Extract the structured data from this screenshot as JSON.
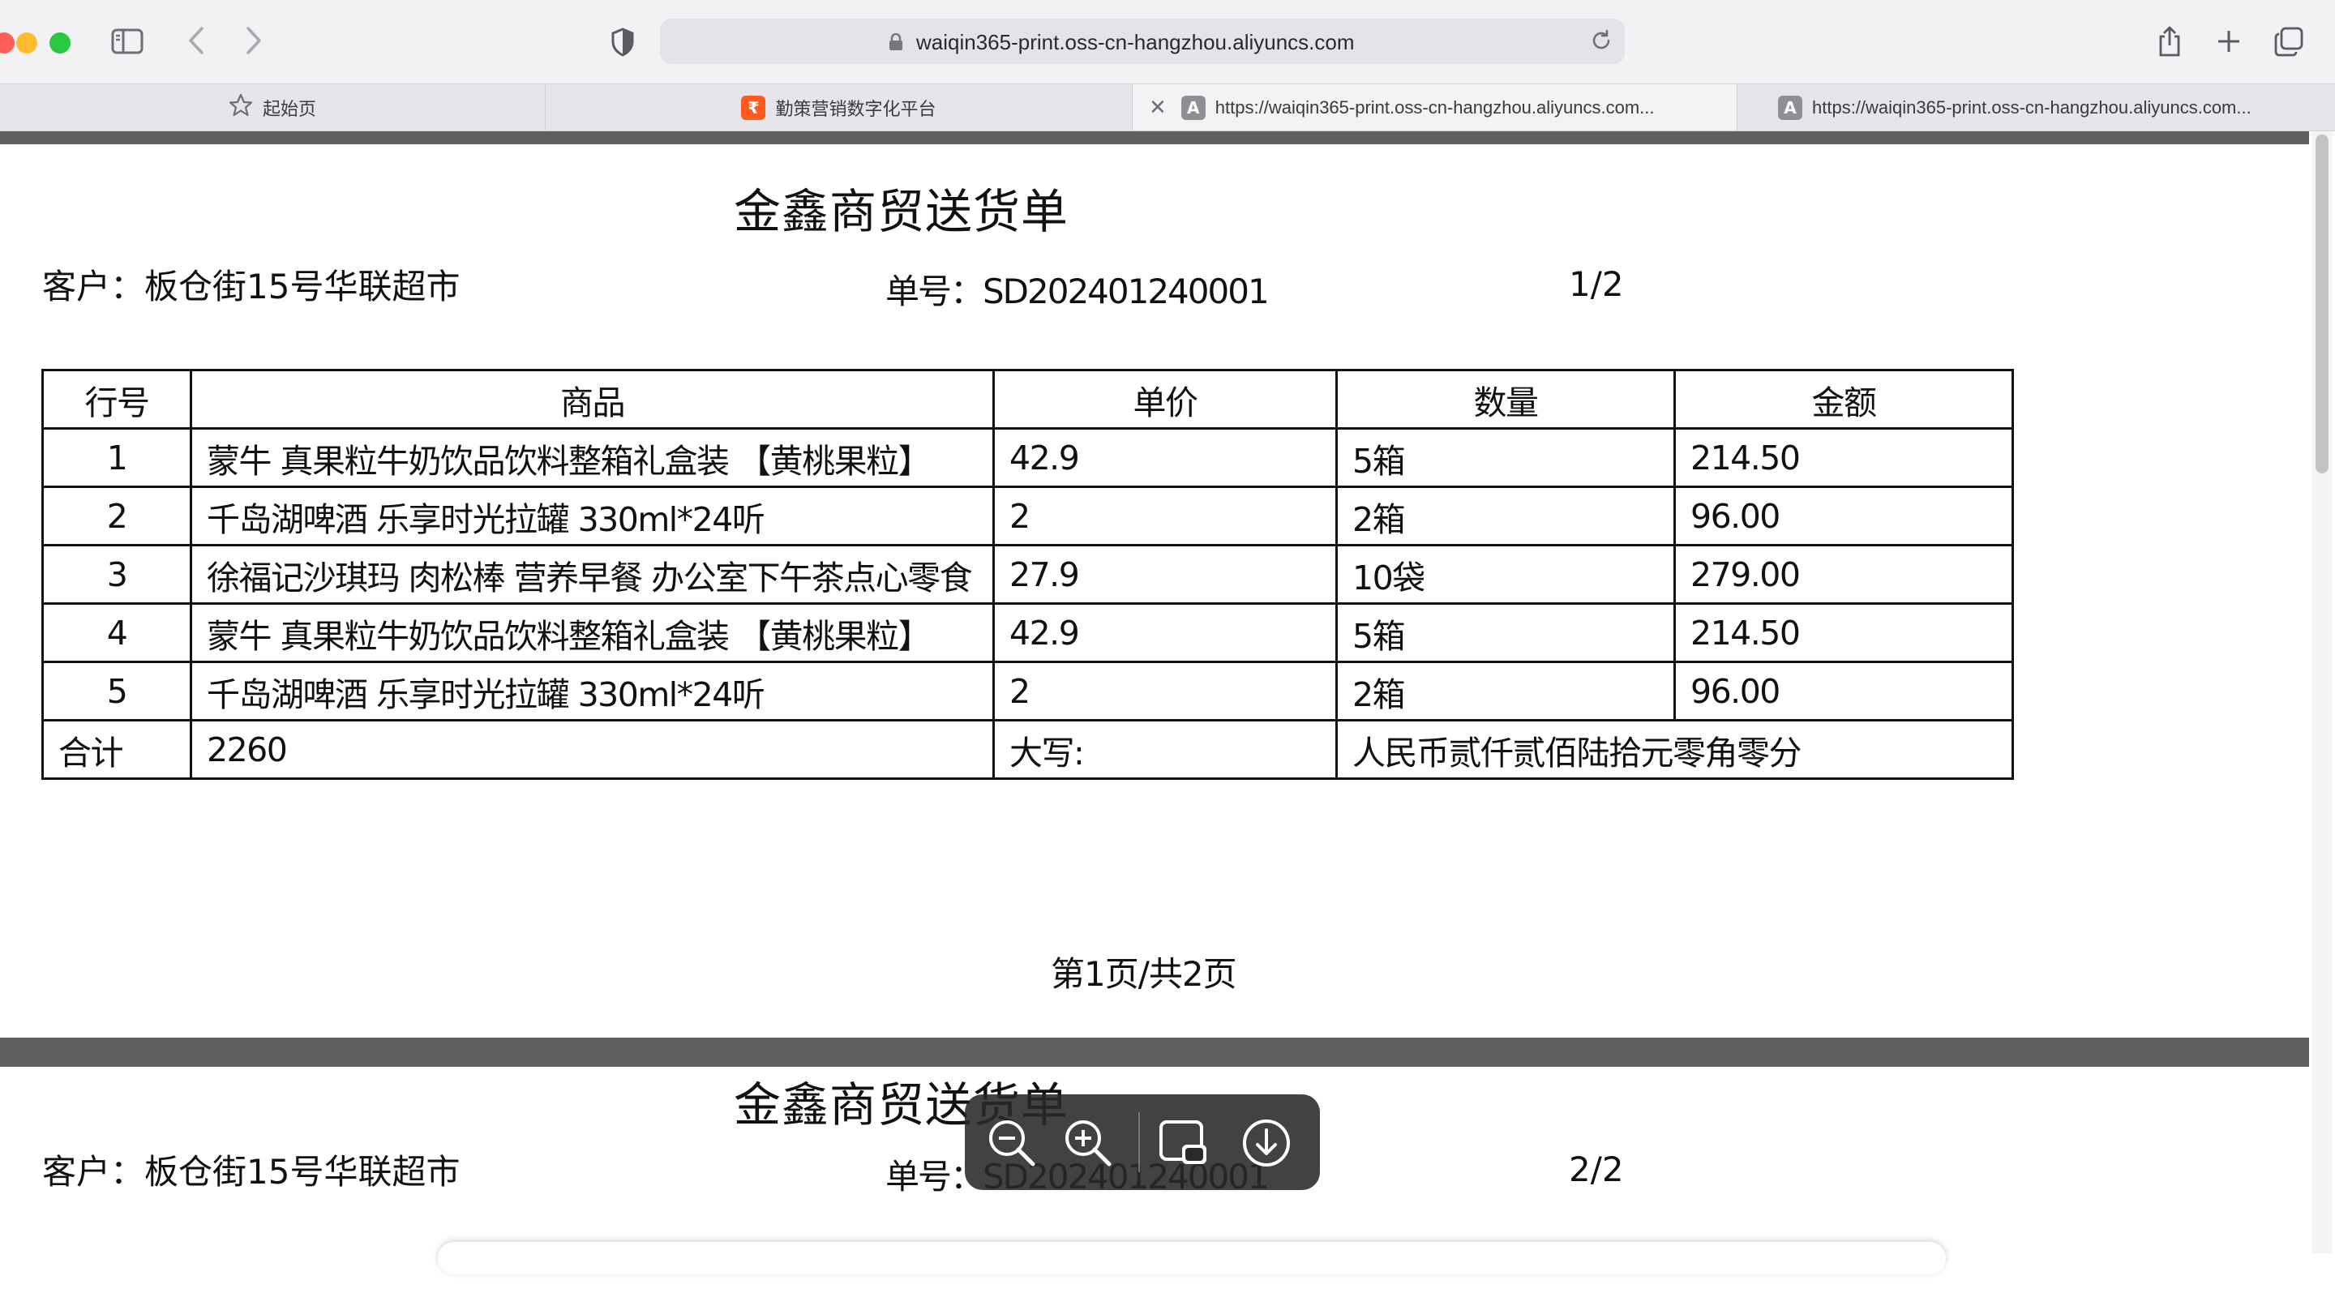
{
  "browser": {
    "url": "waiqin365-print.oss-cn-hangzhou.aliyuncs.com",
    "tabs": [
      {
        "label": "起始页"
      },
      {
        "label": "勤策营销数字化平台"
      },
      {
        "label": "https://waiqin365-print.oss-cn-hangzhou.aliyuncs.com..."
      },
      {
        "label": "https://waiqin365-print.oss-cn-hangzhou.aliyuncs.com..."
      }
    ],
    "favicon_letter": "A"
  },
  "doc": {
    "title": "金鑫商贸送货单",
    "customer": "客户：板仓街15号华联超市",
    "order_no": "单号：SD202401240001",
    "page_index_1": "1/2",
    "page_index_2": "2/2",
    "table": {
      "headers": [
        "行号",
        "商品",
        "单价",
        "数量",
        "金额"
      ],
      "rows": [
        [
          "1",
          "蒙牛 真果粒牛奶饮品饮料整箱礼盒装 【黄桃果粒】",
          "42.9",
          "5箱",
          "214.50"
        ],
        [
          "2",
          "千岛湖啤酒 乐享时光拉罐 330ml*24听",
          "2",
          "2箱",
          "96.00"
        ],
        [
          "3",
          "徐福记沙琪玛 肉松棒 营养早餐 办公室下午茶点心零食",
          "27.9",
          "10袋",
          "279.00"
        ],
        [
          "4",
          "蒙牛 真果粒牛奶饮品饮料整箱礼盒装 【黄桃果粒】",
          "42.9",
          "5箱",
          "214.50"
        ],
        [
          "5",
          "千岛湖啤酒 乐享时光拉罐 330ml*24听",
          "2",
          "2箱",
          "96.00"
        ]
      ],
      "total_label": "合计",
      "total_value": "2260",
      "uppercase_label": "大写:",
      "uppercase_value": "人民币贰仟贰佰陆拾元零角零分"
    },
    "footer": "第1页/共2页"
  },
  "colors": {
    "band": "#5f5f5f",
    "controls_bg": "#2a2a2c",
    "tab_active": "#f3f2f5"
  }
}
